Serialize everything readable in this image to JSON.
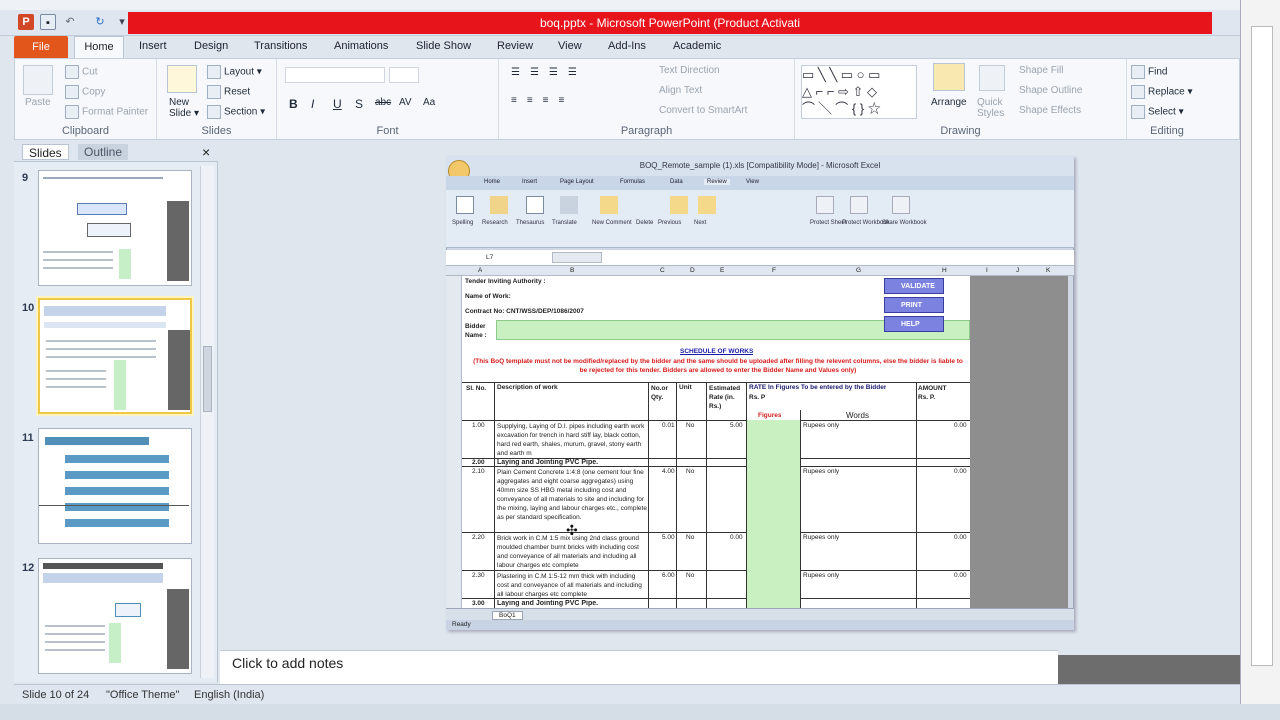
{
  "window": {
    "title": "boq.pptx - Microsoft PowerPoint (Product Activati",
    "accent_red": "#e8141c",
    "file_tab_color": "#e2561c"
  },
  "quick_access": [
    "powerpoint-logo-icon",
    "save-icon",
    "undo-icon",
    "redo-icon",
    "customize-icon"
  ],
  "ribbon": {
    "tabs": [
      "File",
      "Home",
      "Insert",
      "Design",
      "Transitions",
      "Animations",
      "Slide Show",
      "Review",
      "View",
      "Add-Ins",
      "Academic"
    ],
    "clipboard": {
      "label": "Clipboard",
      "paste": "Paste",
      "cut": "Cut",
      "copy": "Copy",
      "format_painter": "Format Painter"
    },
    "slides": {
      "label": "Slides",
      "new_slide": "New Slide ▾",
      "layout": "Layout ▾",
      "reset": "Reset",
      "section": "Section ▾"
    },
    "font": {
      "label": "Font",
      "bold": "B",
      "italic": "I",
      "underline": "U",
      "shadow": "S",
      "strike": "abc",
      "spacing": "AV",
      "case": "Aa"
    },
    "paragraph": {
      "label": "Paragraph",
      "text_direction": "Text Direction",
      "align_text": "Align Text",
      "smartart": "Convert to SmartArt"
    },
    "drawing": {
      "label": "Drawing",
      "arrange": "Arrange",
      "quick_styles": "Quick Styles",
      "shape_fill": "Shape Fill",
      "shape_outline": "Shape Outline",
      "shape_effects": "Shape Effects"
    },
    "editing": {
      "label": "Editing",
      "find": "Find",
      "replace": "Replace ▾",
      "select": "Select ▾"
    }
  },
  "panes": {
    "slides_tab": "Slides",
    "outline_tab": "Outline",
    "close": "×"
  },
  "thumbnails": [
    {
      "num": "9"
    },
    {
      "num": "10"
    },
    {
      "num": "11"
    },
    {
      "num": "12"
    }
  ],
  "embedded_excel": {
    "title": "BOQ_Remote_sample (1).xls [Compatibility Mode] - Microsoft Excel",
    "tabs": [
      "Home",
      "Insert",
      "Page Layout",
      "Formulas",
      "Data",
      "Review",
      "View"
    ],
    "ribbon_buttons": [
      "Spelling",
      "Research",
      "Thesaurus",
      "Translate",
      "New Comment",
      "Delete",
      "Previous",
      "Next",
      "Protect Sheet",
      "Protect Workbook",
      "Share Workbook"
    ],
    "cell_ref": "L7",
    "columns": [
      "A",
      "B",
      "C",
      "D",
      "E",
      "F",
      "G",
      "H",
      "I",
      "J",
      "K"
    ],
    "rows": [
      {
        "label": "Tender Inviting Authority :"
      },
      {
        "label": "Name of Work:"
      },
      {
        "label": "Contract No: CNT/WSS/DEP/1086/2007"
      },
      {
        "label": "Bidder Name :"
      }
    ],
    "buttons": [
      "VALIDATE",
      "PRINT",
      "HELP"
    ],
    "schedule_title": "SCHEDULE OF WORKS",
    "schedule_note": "(This BoQ template must not be modified/replaced by the bidder and the same should be uploaded after filling the relevent columns, else the bidder is liable to be rejected for this tender. Bidders are allowed to enter the Bidder Name and Values only)",
    "headers": {
      "sl": "Sl. No.",
      "desc": "Description of work",
      "qty": "No.or Qty.",
      "unit": "Unit",
      "rate": "Estimated Rate (in. Rs.)",
      "rate_fig": "RATE In Figures To be entered by the Bidder",
      "rs_p": "Rs.    P",
      "figures": "Figures",
      "words": "Words",
      "amount": "AMOUNT Rs.    P."
    },
    "items": [
      {
        "sl": "1.00",
        "desc": "Supplying, Laying of D.I. pipes including earth work excavation for trench in hard stiff lay, black cotton, hard red earth, shales, murum, gravel, stony earth and earth m",
        "qty": "0.01",
        "unit": "No",
        "rate": "5.00",
        "words": "Rupees only",
        "amount": "0.00"
      },
      {
        "sl": "2.00",
        "desc": "Laying and Jointing PVC Pipe."
      },
      {
        "sl": "2.10",
        "desc": "Plain Cement Concrete 1:4:8 (one cement four fine aggregates and eight coarse aggregates) using 40mm size SS HBG metal including cost and conveyance of all materials to site and including for the mixing, laying and labour charges etc., complete as per standard specification.",
        "qty": "4.00",
        "unit": "No",
        "words": "Rupees only",
        "amount": "0.00"
      },
      {
        "sl": "2.20",
        "desc": "Brick work in C.M 1:5 mix using 2nd class ground moulded chamber burnt bricks with including cost and conveyance of all materials and including all labour charges etc complete",
        "qty": "5.00",
        "unit": "No",
        "rate": "0.00",
        "words": "Rupees only",
        "amount": "0.00"
      },
      {
        "sl": "2.30",
        "desc": "Plastering in C.M 1:5-12 mm thick with including cost and conveyance of all materials and including all labour charges etc complete",
        "qty": "6.00",
        "unit": "No",
        "words": "Rupees only",
        "amount": "0.00"
      },
      {
        "sl": "3.00",
        "desc": "Laying and Jointing PVC Pipe."
      }
    ],
    "sheet_tab": "BoQ1",
    "status": "Ready"
  },
  "notes": {
    "placeholder": "Click to add notes"
  },
  "statusbar": {
    "slide": "Slide 10 of 24",
    "theme": "\"Office Theme\"",
    "language": "English (India)"
  }
}
